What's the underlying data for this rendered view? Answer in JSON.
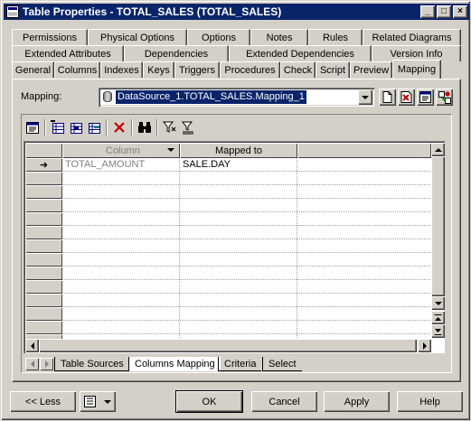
{
  "window": {
    "title": "Table Properties - TOTAL_SALES (TOTAL_SALES)",
    "minimize_glyph": "_",
    "maximize_glyph": "□",
    "close_glyph": "×"
  },
  "tabs": {
    "row1": [
      "Permissions",
      "Physical Options",
      "Options",
      "Notes",
      "Rules",
      "Related Diagrams"
    ],
    "row2": [
      "Extended Attributes",
      "Dependencies",
      "Extended Dependencies",
      "Version Info"
    ],
    "row3": [
      "General",
      "Columns",
      "Indexes",
      "Keys",
      "Triggers",
      "Procedures",
      "Check",
      "Script",
      "Preview",
      "Mapping"
    ],
    "active": "Mapping"
  },
  "mapping": {
    "label": "Mapping:",
    "value": "DataSource_1.TOTAL_SALES.Mapping_1"
  },
  "grid": {
    "columns": [
      "Column",
      "Mapped to"
    ],
    "rows": [
      {
        "column": "TOTAL_AMOUNT",
        "mapped_to": "SALE.DAY"
      }
    ],
    "current_row_glyph": "➜"
  },
  "sheet_tabs": [
    "Table Sources",
    "Columns Mapping",
    "Criteria",
    "Select"
  ],
  "active_sheet_tab": "Columns Mapping",
  "footer": {
    "less_label": "<< Less",
    "ok_label": "OK",
    "cancel_label": "Cancel",
    "apply_label": "Apply",
    "help_label": "Help"
  },
  "colors": {
    "titlebar": "#0a246a",
    "face": "#d4d0c8",
    "delete_icon": "#c00000",
    "muted_text": "#808080"
  },
  "icons": [
    "properties-icon",
    "add-rows-icon",
    "add-columns-icon",
    "add-attributes-icon",
    "delete-icon",
    "find-icon",
    "filter-icon",
    "clear-filter-icon",
    "new-mapping-icon",
    "delete-mapping-icon",
    "mapping-properties-icon",
    "mapping-editor-icon",
    "customize-menu-icon"
  ]
}
